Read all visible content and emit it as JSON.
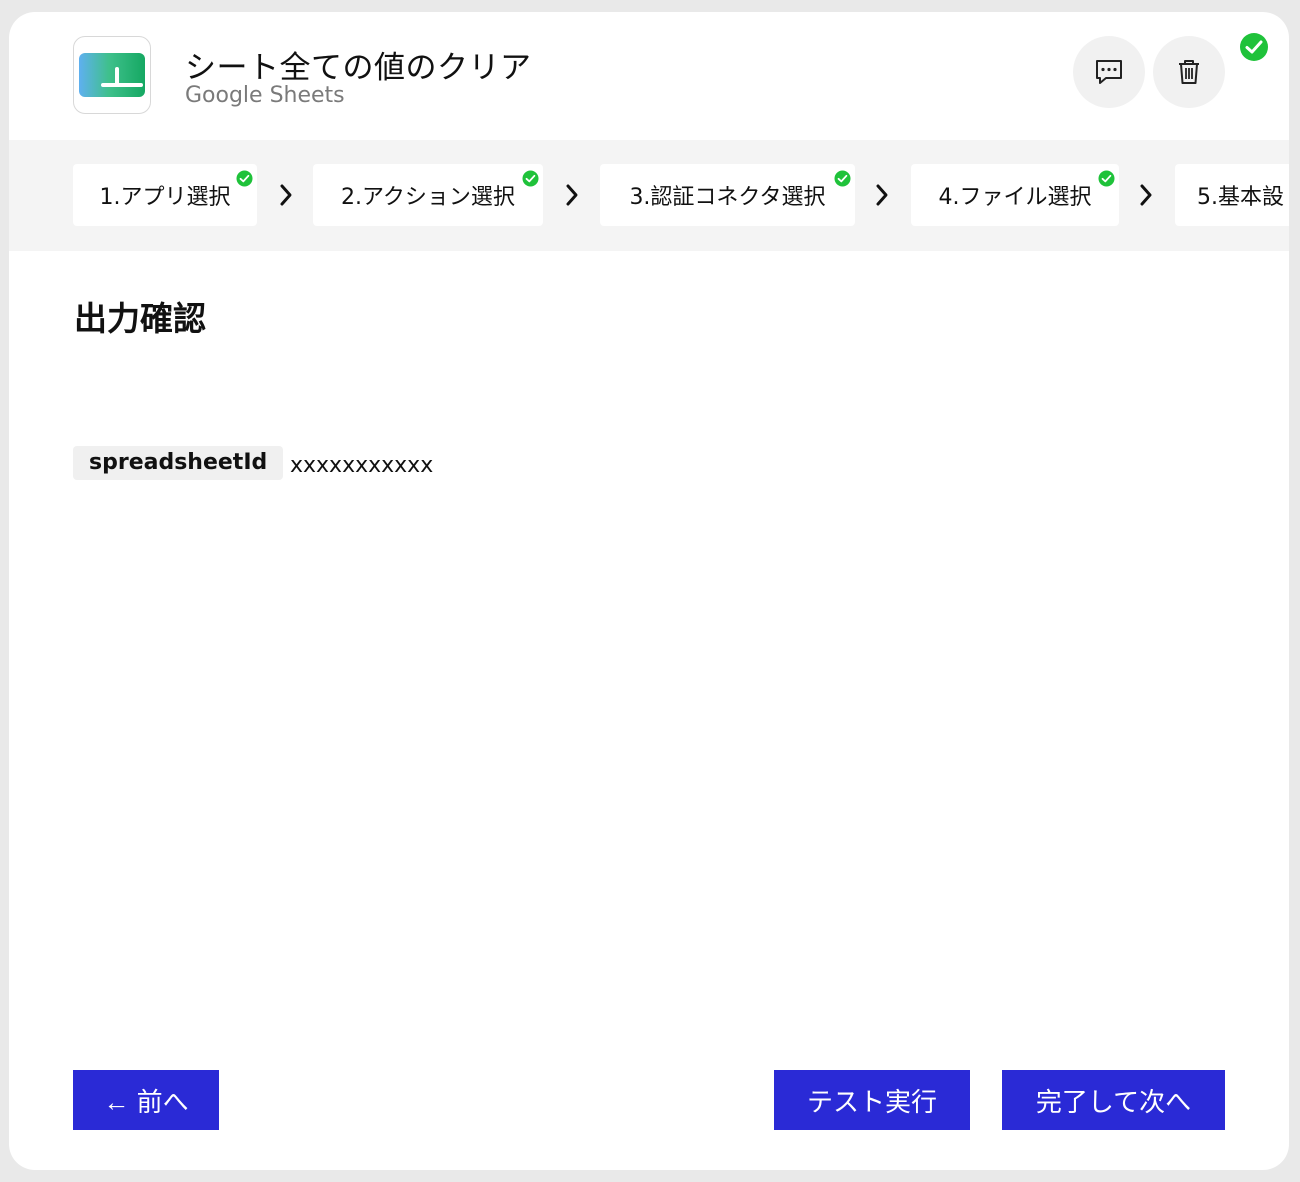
{
  "header": {
    "title": "シート全ての値のクリア",
    "subtitle": "Google Sheets",
    "app_icon": "google-sheets-icon",
    "comment_icon": "comment-icon",
    "trash_icon": "trash-icon",
    "status_icon": "check-circle-icon"
  },
  "steps": [
    {
      "label": "1.アプリ選択",
      "done": true
    },
    {
      "label": "2.アクション選択",
      "done": true
    },
    {
      "label": "3.認証コネクタ選択",
      "done": true
    },
    {
      "label": "4.ファイル選択",
      "done": true
    },
    {
      "label": "5.基本設",
      "done": false
    }
  ],
  "main": {
    "section_title": "出力確認",
    "params": [
      {
        "key": "spreadsheetId",
        "value": "xxxxxxxxxxx"
      }
    ]
  },
  "footer": {
    "prev_label": "← 前へ",
    "test_label": "テスト実行",
    "next_label": "完了して次へ"
  },
  "colors": {
    "accent": "#2a2ad6",
    "success": "#1fc23a",
    "step_bar_bg": "#f4f4f4"
  }
}
